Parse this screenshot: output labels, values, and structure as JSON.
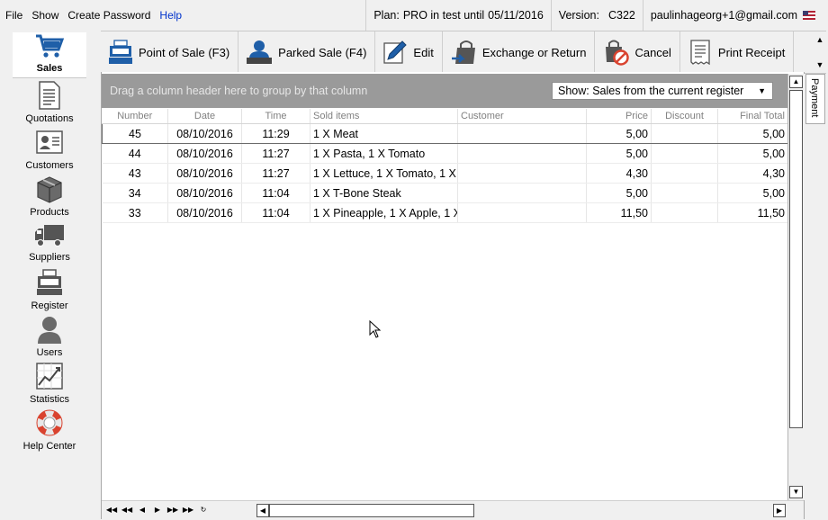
{
  "menu": {
    "file": "File",
    "show": "Show",
    "create_password": "Create Password",
    "help": "Help"
  },
  "status": {
    "plan_label": "Plan:",
    "plan_value": "PRO in test until",
    "plan_date": "05/11/2016",
    "version_label": "Version:",
    "version_value": "C322",
    "email": "paulinhageorg+1@gmail.com"
  },
  "sidebar": [
    {
      "label": "Sales",
      "icon": "cart-icon",
      "active": true
    },
    {
      "label": "Quotations",
      "icon": "document-icon"
    },
    {
      "label": "Customers",
      "icon": "id-card-icon"
    },
    {
      "label": "Products",
      "icon": "box-icon"
    },
    {
      "label": "Suppliers",
      "icon": "truck-icon"
    },
    {
      "label": "Register",
      "icon": "cash-register-icon"
    },
    {
      "label": "Users",
      "icon": "user-icon"
    },
    {
      "label": "Statistics",
      "icon": "chart-icon"
    },
    {
      "label": "Help Center",
      "icon": "lifebuoy-icon"
    }
  ],
  "toolbar": {
    "point_of_sale": "Point of Sale (F3)",
    "parked_sale": "Parked Sale (F4)",
    "edit": "Edit",
    "exchange": "Exchange or Return",
    "cancel": "Cancel",
    "print_receipt": "Print Receipt"
  },
  "grid": {
    "group_hint": "Drag a column header here to group by that column",
    "filter": "Show: Sales from the current register",
    "columns": [
      "Number",
      "Date",
      "Time",
      "Sold items",
      "Customer",
      "Price",
      "Discount",
      "Final Total"
    ],
    "rows": [
      [
        "45",
        "08/10/2016",
        "11:29",
        "1 X Meat",
        "",
        "5,00",
        "",
        "5,00"
      ],
      [
        "44",
        "08/10/2016",
        "11:27",
        "1 X Pasta, 1 X Tomato",
        "",
        "5,00",
        "",
        "5,00"
      ],
      [
        "43",
        "08/10/2016",
        "11:27",
        "1 X Lettuce, 1 X Tomato, 1 X",
        "",
        "4,30",
        "",
        "4,30"
      ],
      [
        "34",
        "08/10/2016",
        "11:04",
        "1 X T-Bone Steak",
        "",
        "5,00",
        "",
        "5,00"
      ],
      [
        "33",
        "08/10/2016",
        "11:04",
        "1 X Pineapple, 1 X Apple, 1 X",
        "",
        "11,50",
        "",
        "11,50"
      ]
    ]
  },
  "side_tab": "Payment",
  "colors": {
    "group_bar": "#9a9a9a",
    "link": "#0033cc",
    "icon_blue": "#1f5fa8"
  }
}
